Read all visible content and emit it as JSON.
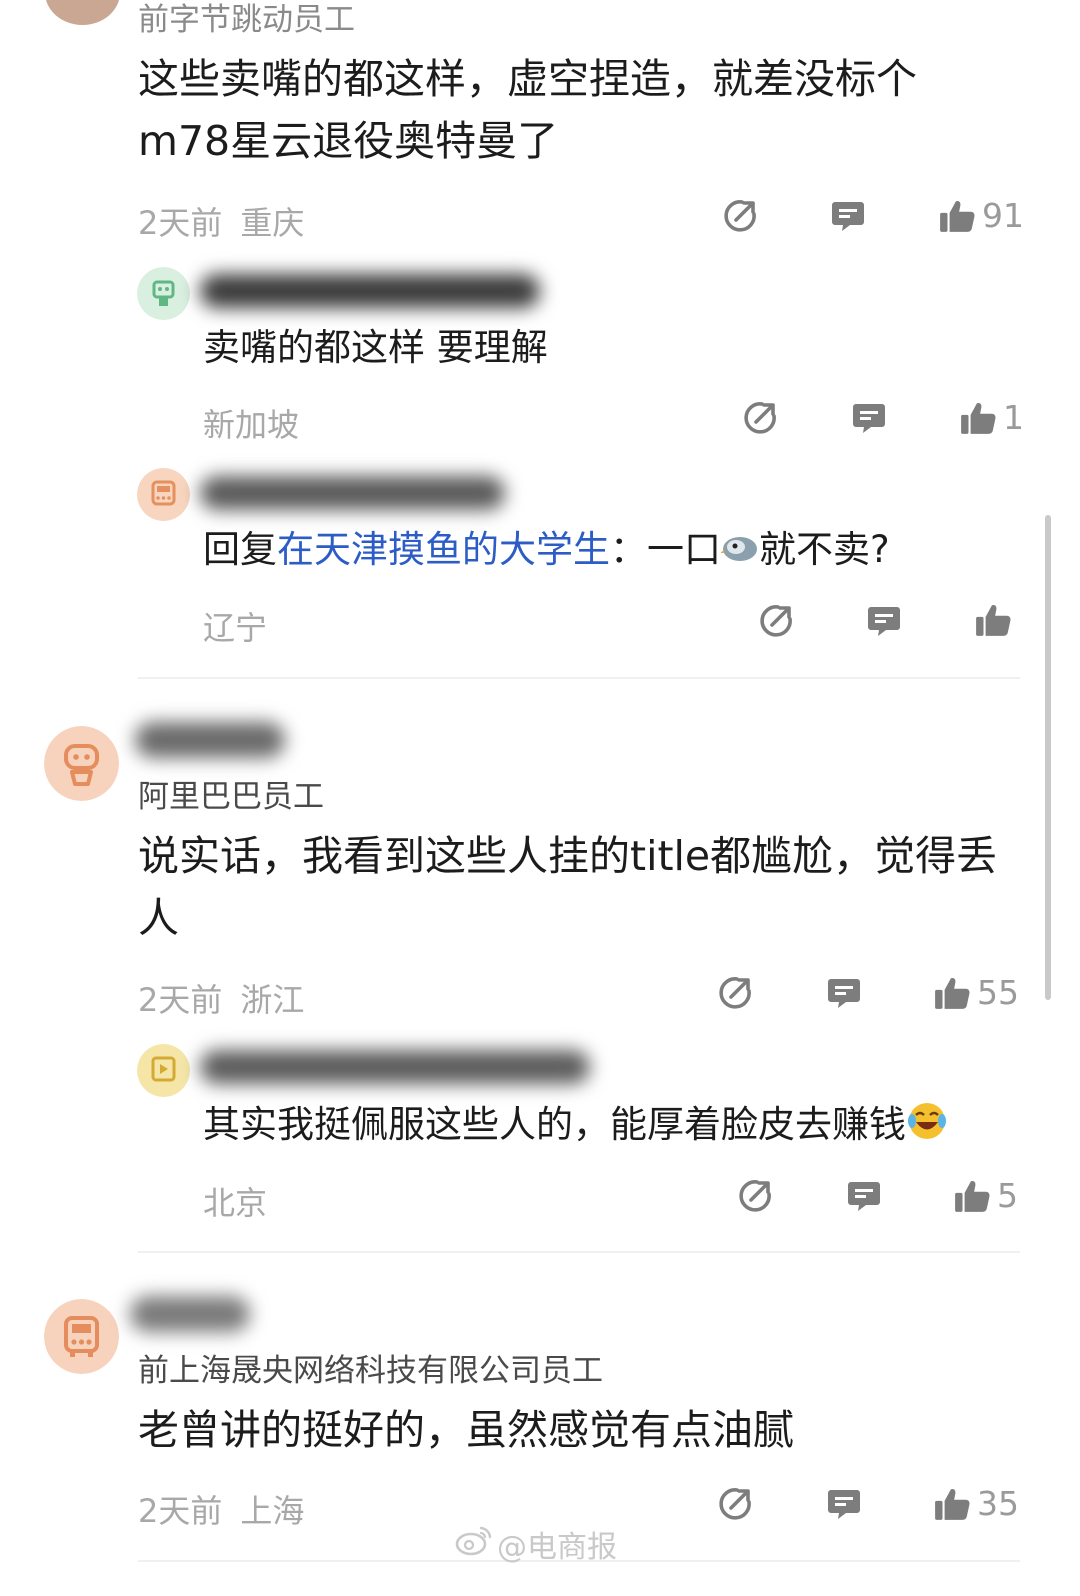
{
  "comments": [
    {
      "company": "前字节跳动员工",
      "text": "这些卖嘴的都这样，虚空捏造，就差没标个m78星云退役奥特曼了",
      "time": "2天前",
      "location": "重庆",
      "likes": "91",
      "replies": [
        {
          "text": "卖嘴的都这样 要理解",
          "location": "新加坡",
          "likes": "1"
        },
        {
          "reply_prefix": "回复",
          "reply_to": "在天津摸鱼的大学生",
          "reply_colon": "：",
          "text_before": "一口",
          "text_after": "就不卖?",
          "location": "辽宁",
          "likes": ""
        }
      ]
    },
    {
      "company": "阿里巴巴员工",
      "text": "说实话，我看到这些人挂的title都尴尬，觉得丢人",
      "time": "2天前",
      "location": "浙江",
      "likes": "55",
      "replies": [
        {
          "text": "其实我挺佩服这些人的，能厚着脸皮去赚钱",
          "location": "北京",
          "likes": "5"
        }
      ]
    },
    {
      "company": "前上海晟央网络科技有限公司员工",
      "text": "老曾讲的挺好的，虽然感觉有点油腻",
      "time": "2天前",
      "location": "上海",
      "likes": "35",
      "replies": []
    }
  ],
  "watermark": {
    "text": "@电商报"
  },
  "icons": {
    "share": "share-icon",
    "comment": "comment-icon",
    "like": "thumbs-up-icon"
  },
  "colors": {
    "icon": "#7d7d7d",
    "meta": "#a8a8a8",
    "link": "#2c5cc5"
  }
}
